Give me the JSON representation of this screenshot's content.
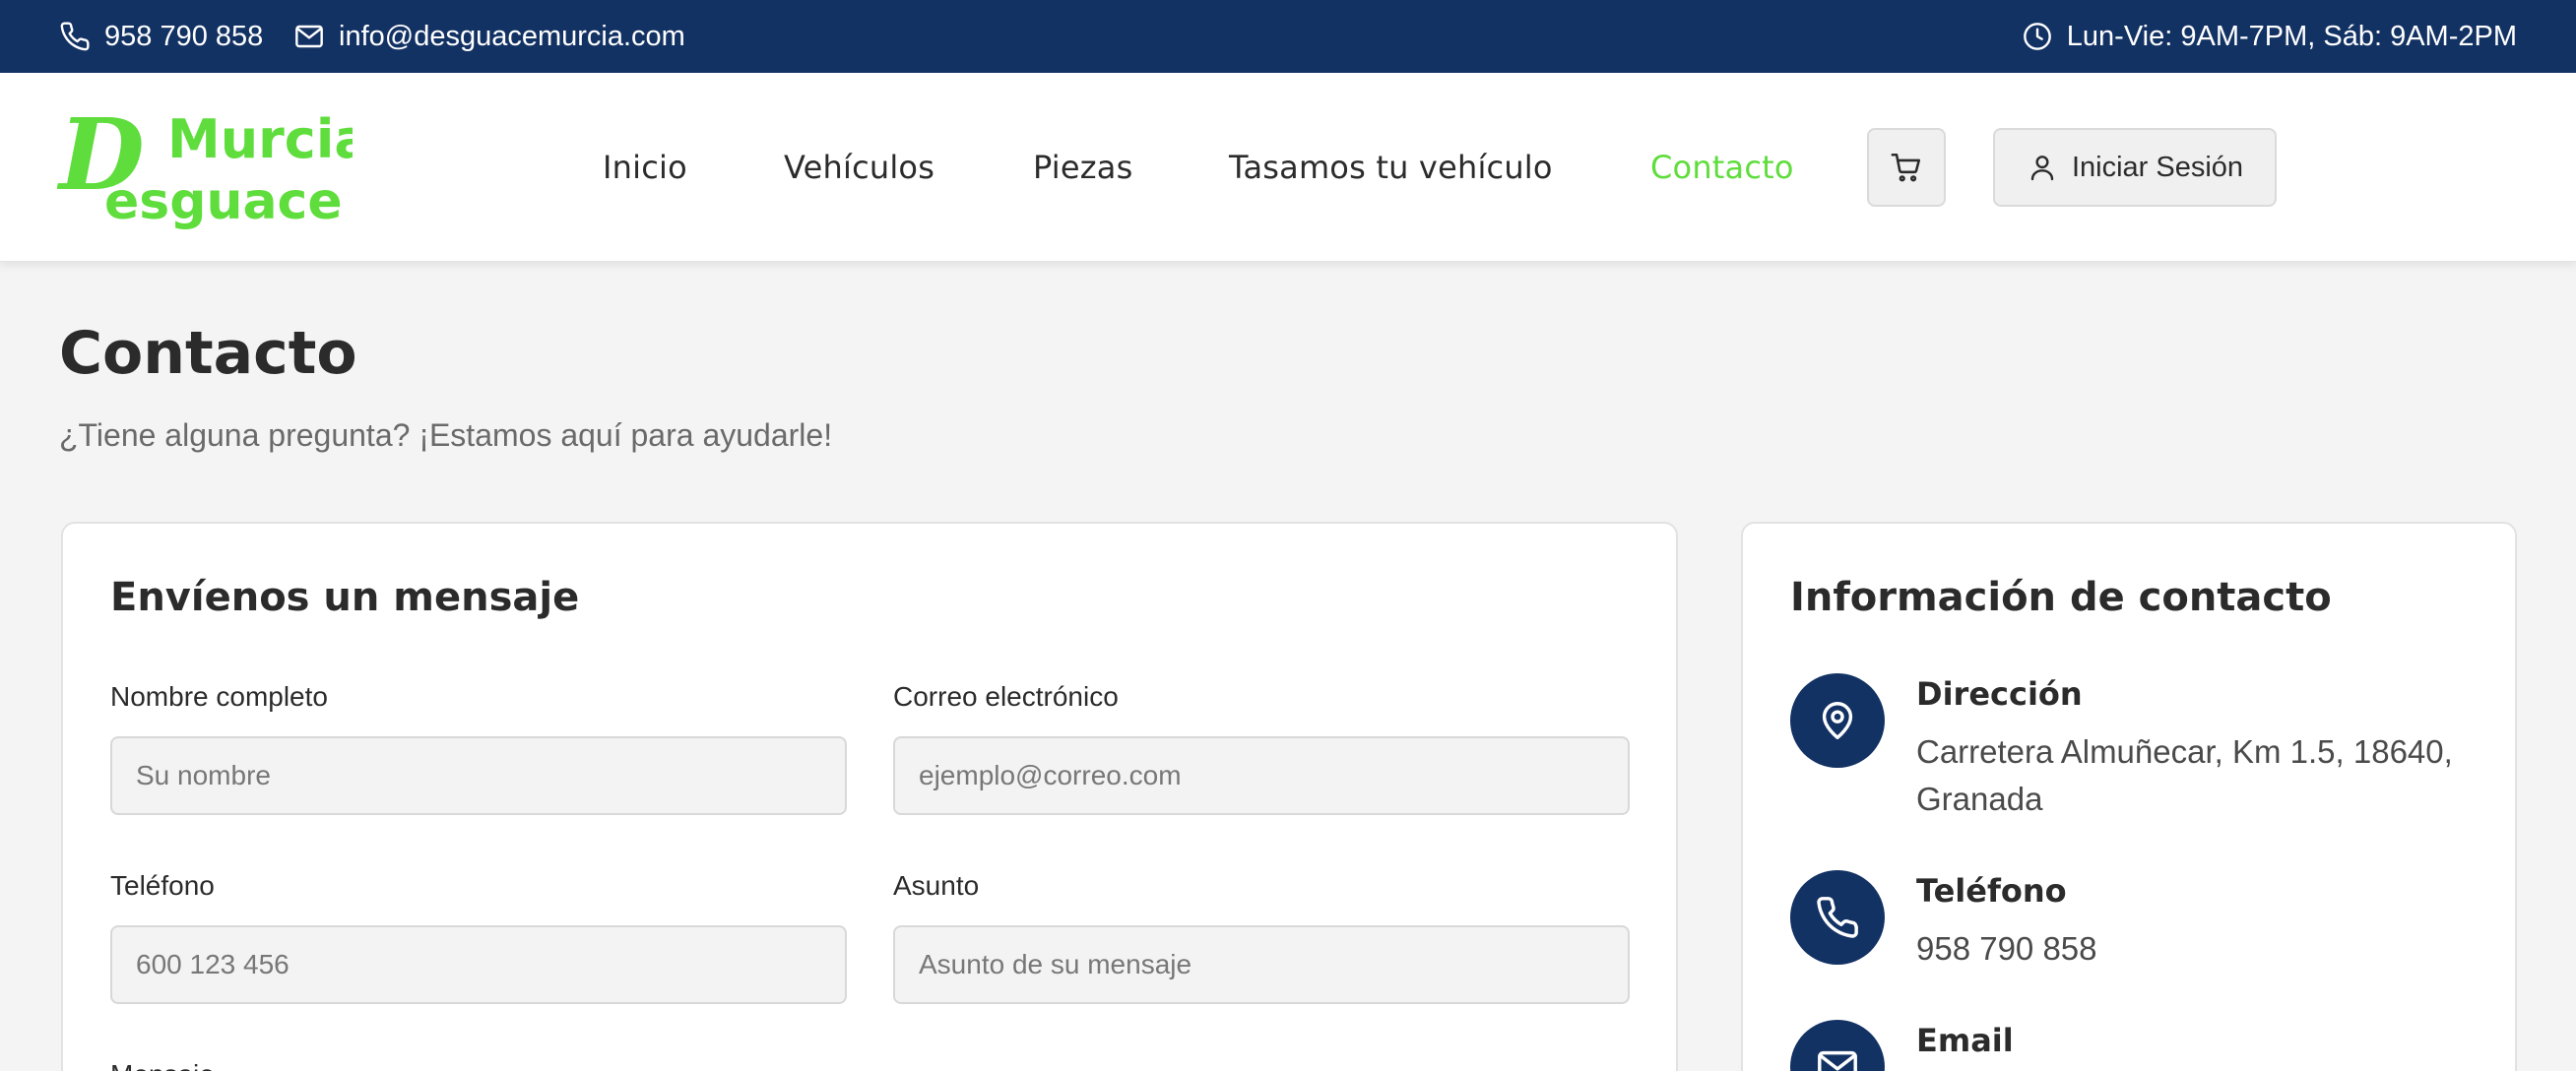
{
  "topbar": {
    "phone": "958 790 858",
    "email": "info@desguacemurcia.com",
    "hours": "Lun-Vie: 9AM-7PM, Sáb: 9AM-2PM"
  },
  "logo": {
    "line1": "D Murcia",
    "line2": "esguace",
    "color": "#5fdd3c"
  },
  "nav": {
    "items": [
      {
        "label": "Inicio"
      },
      {
        "label": "Vehículos"
      },
      {
        "label": "Piezas"
      },
      {
        "label": "Tasamos tu vehículo"
      },
      {
        "label": "Contacto",
        "active": true
      }
    ],
    "login_label": "Iniciar Sesión"
  },
  "page": {
    "title": "Contacto",
    "subtitle": "¿Tiene alguna pregunta? ¡Estamos aquí para ayudarle!"
  },
  "form": {
    "title": "Envíenos un mensaje",
    "fields": [
      {
        "label": "Nombre completo",
        "placeholder": "Su nombre"
      },
      {
        "label": "Correo electrónico",
        "placeholder": "ejemplo@correo.com"
      },
      {
        "label": "Teléfono",
        "placeholder": "600 123 456"
      },
      {
        "label": "Asunto",
        "placeholder": "Asunto de su mensaje"
      }
    ],
    "message_label": "Mensaje"
  },
  "info": {
    "title": "Información de contacto",
    "address_heading": "Dirección",
    "address_line1": "Carretera Almuñecar, Km 1.5, 18640,",
    "address_line2": "Granada",
    "phone_heading": "Teléfono",
    "phone": "958 790 858",
    "email_heading": "Email"
  },
  "colors": {
    "primary": "#133264",
    "accent": "#5fdd3c",
    "background": "#f4f4f4"
  },
  "icons": [
    "phone-icon",
    "mail-icon",
    "clock-icon",
    "cart-icon",
    "user-icon",
    "map-pin-icon"
  ]
}
